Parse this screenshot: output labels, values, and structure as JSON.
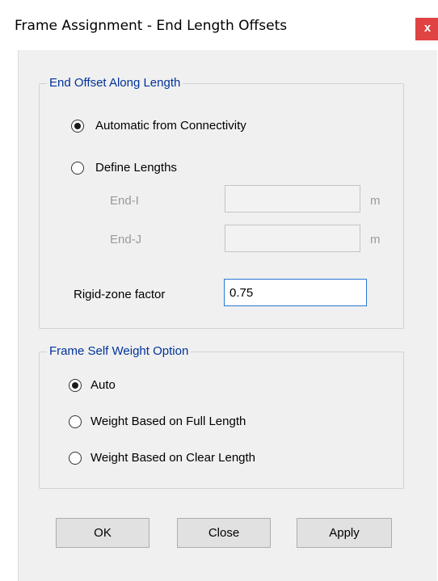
{
  "window": {
    "title": "Frame Assignment - End Length Offsets",
    "close_label": "x"
  },
  "end_offset": {
    "title": "End Offset Along Length",
    "options": [
      {
        "label": "Automatic from Connectivity",
        "checked": true
      },
      {
        "label": "Define Lengths",
        "checked": false
      }
    ],
    "end_i_label": "End-I",
    "end_i_value": "",
    "end_i_unit": "m",
    "end_j_label": "End-J",
    "end_j_value": "",
    "end_j_unit": "m",
    "rigid_zone_label": "Rigid-zone factor",
    "rigid_zone_value": "0.75"
  },
  "self_weight": {
    "title": "Frame Self Weight Option",
    "options": [
      {
        "label": "Auto",
        "checked": true
      },
      {
        "label": "Weight Based on Full Length",
        "checked": false
      },
      {
        "label": "Weight Based on Clear Length",
        "checked": false
      }
    ]
  },
  "buttons": {
    "ok": "OK",
    "close": "Close",
    "apply": "Apply"
  }
}
